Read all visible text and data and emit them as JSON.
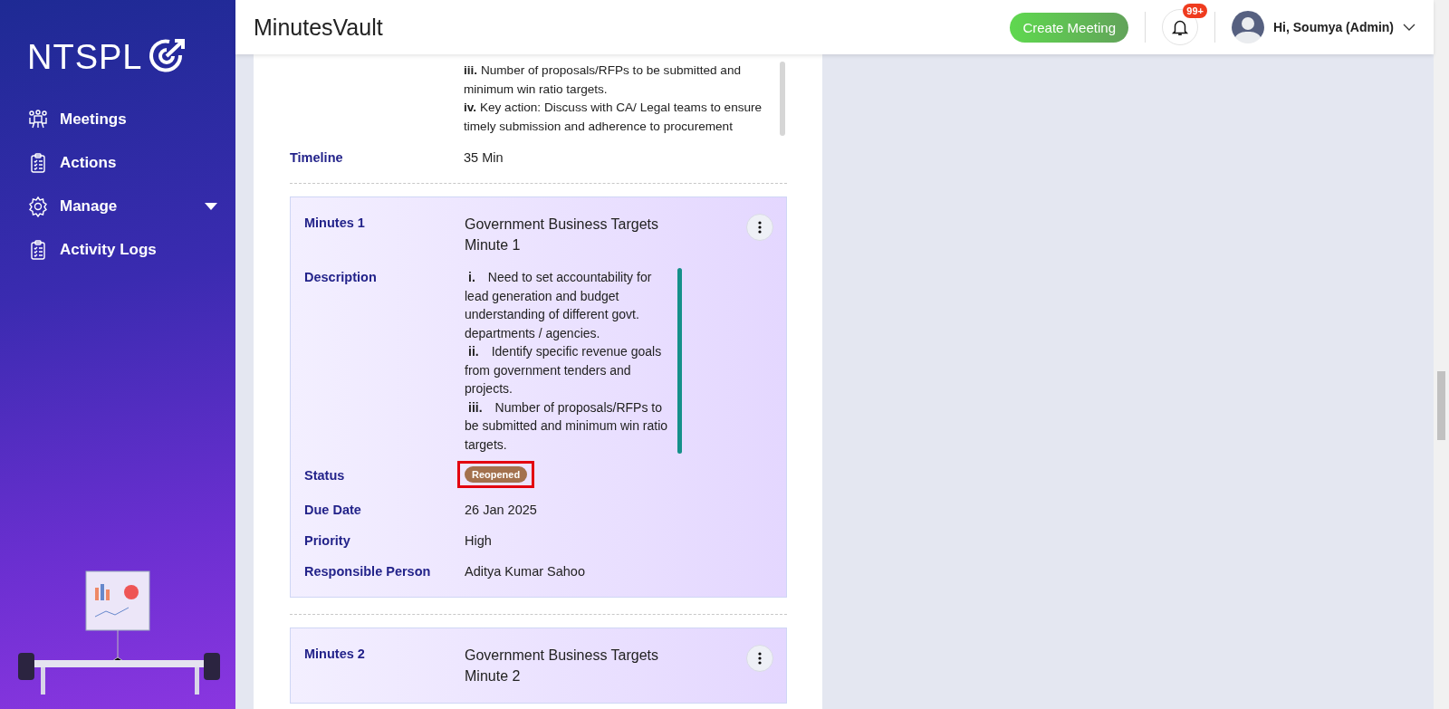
{
  "sidebar": {
    "logo": "NTSPL",
    "items": [
      {
        "label": "Meetings",
        "kind": "link"
      },
      {
        "label": "Actions",
        "kind": "link"
      },
      {
        "label": "Manage",
        "kind": "group"
      },
      {
        "label": "Activity Logs",
        "kind": "link"
      }
    ]
  },
  "header": {
    "title": "MinutesVault",
    "create_button": "Create Meeting",
    "notification_badge": "99+",
    "user_greeting": "Hi, Soumya (Admin)"
  },
  "agenda": {
    "description": [
      "**iii.** Number of proposals/RFPs to be submitted and minimum win ratio targets.",
      "**iv.** Key action: Discuss with CA/ Legal teams to ensure timely submission and adherence to procurement"
    ],
    "fields": [
      {
        "label": "Timeline",
        "value": "35 Min"
      }
    ]
  },
  "minutes": [
    {
      "label": "Minutes 1",
      "title": "Government Business Targets Minute 1",
      "fields": [
        {
          "kind": "list",
          "label": "Description",
          "items": [
            {
              "marker": "i.",
              "text": "Need to set accountability for lead generation and budget understanding of different govt. departments / agencies."
            },
            {
              "marker": "ii.",
              "text": "Identify specific revenue goals from government tenders and projects."
            },
            {
              "marker": "iii.",
              "text": "Number of proposals/RFPs to be submitted and minimum win ratio targets."
            }
          ]
        },
        {
          "kind": "badge",
          "label": "Status",
          "value": "Reopened",
          "color": "#a3714d",
          "highlighted": true
        },
        {
          "kind": "text",
          "label": "Due Date",
          "value": "26 Jan 2025"
        },
        {
          "kind": "text",
          "label": "Priority",
          "value": "High"
        },
        {
          "kind": "text",
          "label": "Responsible Person",
          "value": "Aditya Kumar Sahoo"
        }
      ]
    },
    {
      "label": "Minutes 2",
      "title": "Government Business Targets Minute 2"
    }
  ]
}
